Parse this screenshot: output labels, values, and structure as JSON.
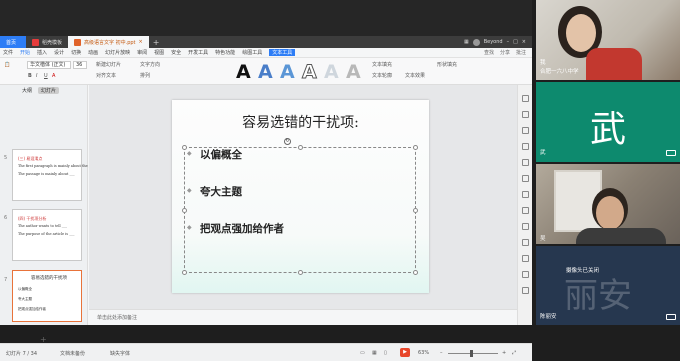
{
  "tabs": {
    "home": "首页",
    "wps": "稻壳模板",
    "doc": "高级语言文字 初中.ppt",
    "plus": "+"
  },
  "user": "Beyond",
  "menu": [
    "文件",
    "开始",
    "插入",
    "设计",
    "切换",
    "动画",
    "幻灯片放映",
    "审阅",
    "视图",
    "安全",
    "开发工具",
    "特色功能",
    "绘图工具",
    "文本工具"
  ],
  "menu_right": [
    "查找",
    "分享",
    "批注"
  ],
  "ribbon": {
    "font": "华文楷体 (正文)",
    "size": "36",
    "new_slide": "新建幻灯片",
    "fill": "文本填充",
    "outline": "文本轮廓",
    "effect": "文本效果",
    "wrap": "形状填充",
    "arrange": "排列",
    "text_direction": "文字方向",
    "align": "对齐文本"
  },
  "slide_panel": {
    "tab_outline": "大纲",
    "tab_slides": "幻灯片",
    "thumbs": [
      {
        "num": "5",
        "red": "(三) 易混淆点",
        "lines": [
          "The first paragraph is mainly about the ___",
          "The passage is mainly about ___"
        ]
      },
      {
        "num": "6",
        "red": "(四) 干扰项分析",
        "lines": [
          "The author wants to tell ___",
          "The purpose of the article is ___"
        ]
      },
      {
        "num": "7",
        "title": "容易选错的干扰项",
        "lines": [
          "以偏概全",
          "夸大主题",
          "把观点强加给作者"
        ]
      }
    ],
    "add": "+"
  },
  "slide": {
    "title": "容易选错的干扰项:",
    "bullets": [
      "以偏概全",
      "夸大主题",
      "把观点强加给作者"
    ]
  },
  "notes": "单击此处添加备注",
  "status": {
    "slide_count": "幻灯片 7 / 34",
    "theme": "Office主题",
    "backup": "文档未备份",
    "missing_font": "缺失字体",
    "zoom": "63%"
  },
  "video": [
    {
      "name": "我",
      "sub": "合肥一六八中学"
    },
    {
      "name": "武",
      "big": "武"
    },
    {
      "name": "吴"
    },
    {
      "name": "陈丽安",
      "ghost": "丽安",
      "note": "摄像头已关闭"
    }
  ]
}
